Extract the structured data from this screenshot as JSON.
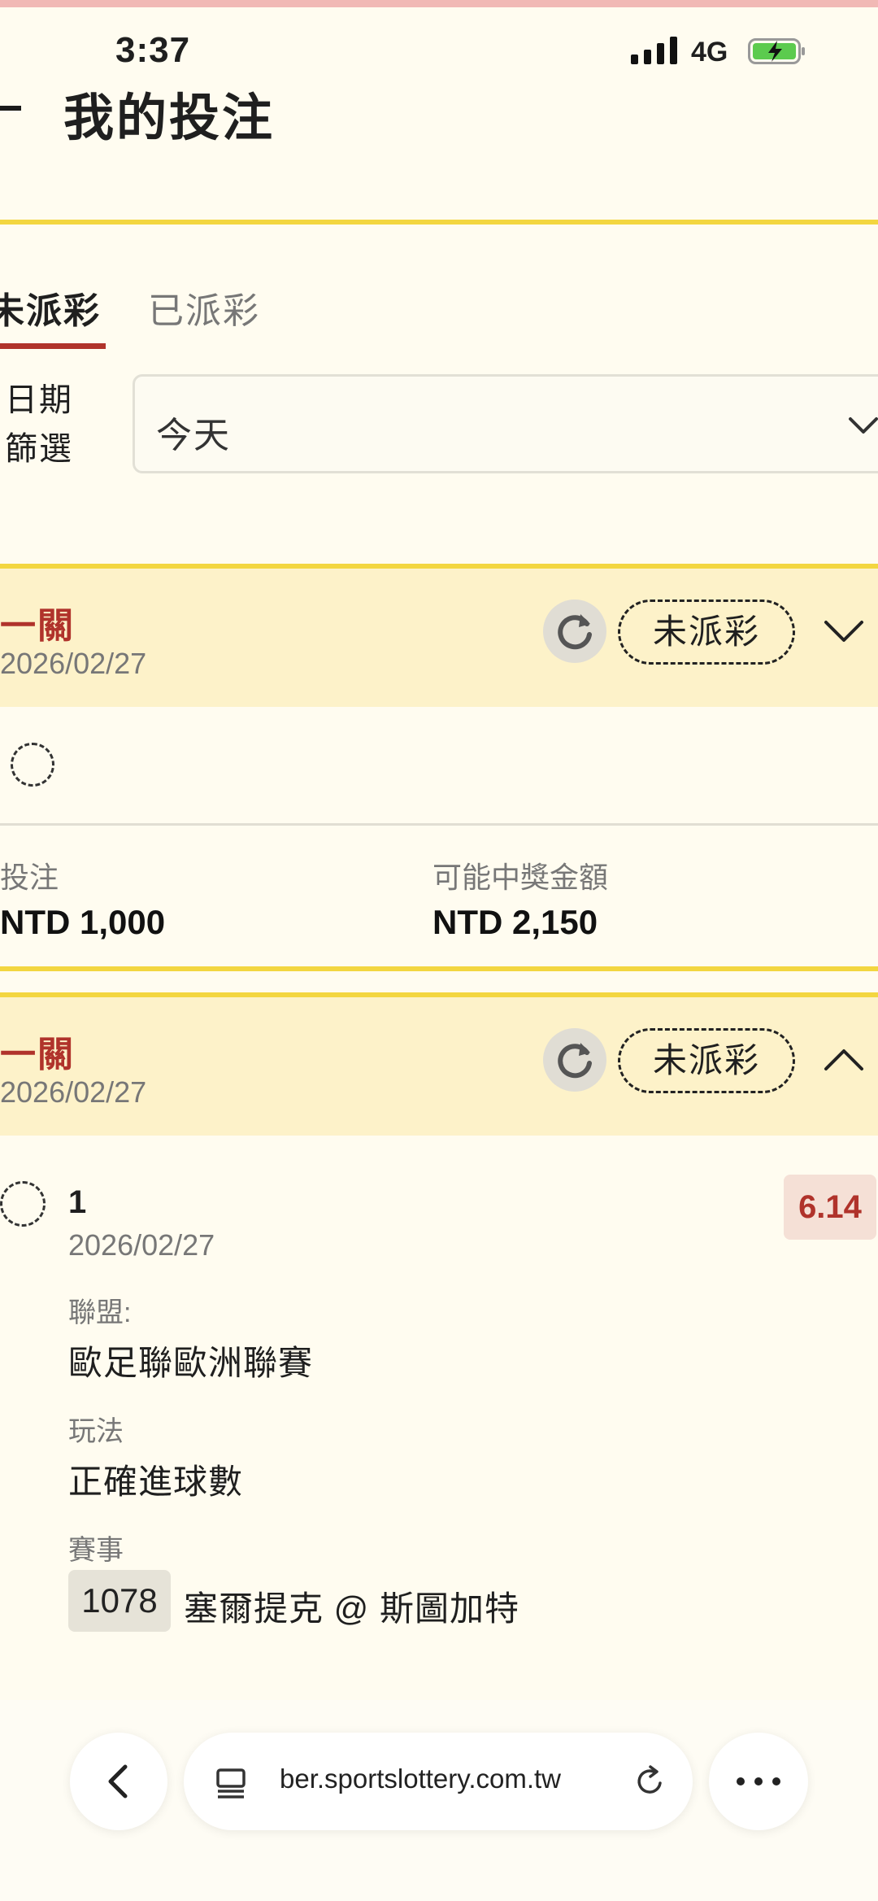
{
  "status_bar": {
    "time": "3:37",
    "network": "4G",
    "icons": [
      "signal-icon",
      "battery-charging-icon"
    ]
  },
  "header": {
    "title": "我的投注"
  },
  "tabs": [
    {
      "label": "未派彩",
      "active": true
    },
    {
      "label": "已派彩",
      "active": false
    }
  ],
  "filter": {
    "label": "日期篩選",
    "value": "今天"
  },
  "bets": [
    {
      "type": "一關",
      "date": "2026/02/27",
      "status": "未派彩",
      "expanded": false,
      "stake_label": "投注",
      "stake_value": "NTD 1,000",
      "payout_label": "可能中獎金額",
      "payout_value": "NTD 2,150"
    },
    {
      "type": "一關",
      "date": "2026/02/27",
      "status": "未派彩",
      "expanded": true,
      "selection": {
        "name": "1",
        "date": "2026/02/27",
        "odds": "6.14",
        "league_label": "聯盟:",
        "league": "歐足聯歐洲聯賽",
        "market_label": "玩法",
        "market": "正確進球數",
        "event_label": "賽事",
        "event_code": "1078",
        "event_name": "塞爾提克 @ 斯圖加特"
      }
    }
  ],
  "browser": {
    "url": "ber.sportslottery.com.tw"
  },
  "colors": {
    "accent_red": "#b0332b",
    "accent_yellow": "#f3d640",
    "card_header_bg": "#fdf2c9",
    "page_bg": "#fffcf0"
  }
}
